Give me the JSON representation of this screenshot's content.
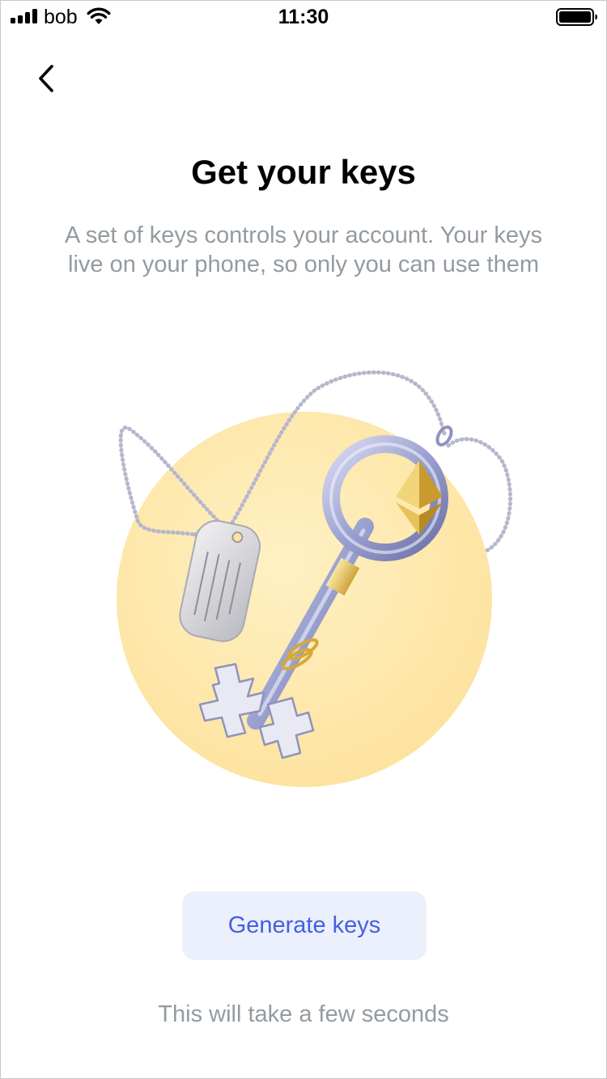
{
  "status_bar": {
    "carrier": "bob",
    "time": "11:30",
    "icons": [
      "signal-icon",
      "wifi-icon",
      "battery-icon"
    ]
  },
  "nav": {
    "back_icon": "chevron-left-icon"
  },
  "content": {
    "title": "Get your keys",
    "subtitle": "A set of keys controls your account. Your keys live on your phone, so only you can use them",
    "illustration": "keys-illustration"
  },
  "actions": {
    "generate_label": "Generate keys",
    "hint": "This will take a few seconds"
  },
  "colors": {
    "accent": "#4360df",
    "button_bg": "#eceffc",
    "secondary_text": "#939ba1",
    "circle": "#fde7a6"
  }
}
